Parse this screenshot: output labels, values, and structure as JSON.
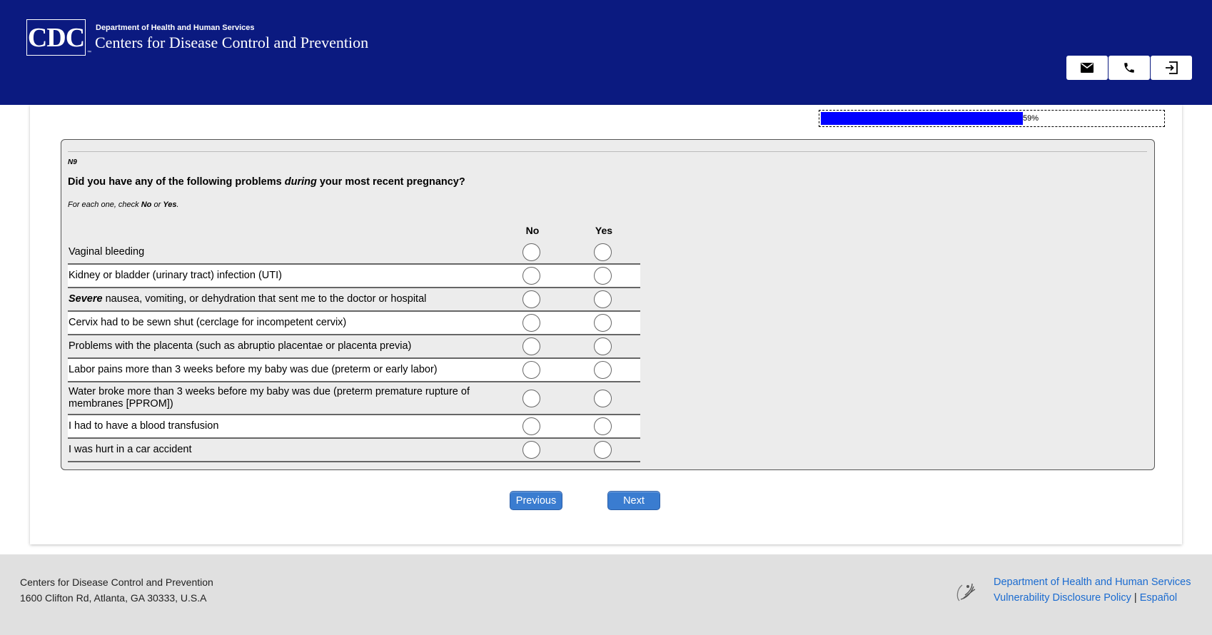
{
  "header": {
    "logo_text": "CDC",
    "logo_mark": "™",
    "department": "Department of Health and Human Services",
    "organization": "Centers for Disease Control and Prevention",
    "buttons": [
      {
        "icon": "mail-icon"
      },
      {
        "icon": "phone-icon"
      },
      {
        "icon": "exit-icon"
      }
    ]
  },
  "progress": {
    "percent_value": 59,
    "label": "59%"
  },
  "question": {
    "id": "N9",
    "text_before": "Did you have any of the following problems ",
    "text_em": "during",
    "text_after": " your most recent pregnancy?",
    "instruction_before": "For each one, check ",
    "instruction_no": "No",
    "instruction_or": " or ",
    "instruction_yes": "Yes",
    "instruction_end": ".",
    "columns": [
      "No",
      "Yes"
    ],
    "rows": [
      {
        "label": "Vaginal bleeding"
      },
      {
        "label": "Kidney or bladder (urinary tract) infection (UTI)"
      },
      {
        "label_em": "Severe",
        "label": " nausea, vomiting, or dehydration that sent me to the doctor or hospital"
      },
      {
        "label": "Cervix had to be sewn shut (cerclage for incompetent cervix)"
      },
      {
        "label": "Problems with the placenta (such as abruptio placentae or placenta previa)"
      },
      {
        "label": "Labor pains more than 3 weeks before my baby was due (preterm or early labor)"
      },
      {
        "label": "Water broke more than 3 weeks before my baby was due (preterm premature rupture of membranes [PPROM])"
      },
      {
        "label": "I had to have a blood transfusion"
      },
      {
        "label": "I was hurt in a car accident"
      }
    ]
  },
  "nav": {
    "previous_label": "Previous",
    "next_label": "Next"
  },
  "footer": {
    "org": "Centers for Disease Control and Prevention",
    "address": "1600 Clifton Rd, Atlanta, GA 30333, U.S.A",
    "hhs_link": "Department of Health and Human Services",
    "vdp_link": "Vulnerability Disclosure Policy",
    "separator": "|",
    "espanol_link": "Español"
  }
}
